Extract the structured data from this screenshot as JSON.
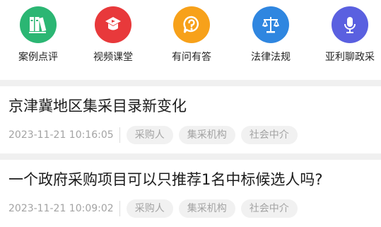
{
  "quick_nav": {
    "items": [
      {
        "label": "案例点评",
        "icon": "books-icon",
        "color": "#2bb673"
      },
      {
        "label": "视频课堂",
        "icon": "video-course-icon",
        "color": "#e8393b"
      },
      {
        "label": "有问有答",
        "icon": "question-bubble-icon",
        "color": "#f7a11a"
      },
      {
        "label": "法律法规",
        "icon": "scales-icon",
        "color": "#2f86e0"
      },
      {
        "label": "亚利聊政采",
        "icon": "microphone-icon",
        "color": "#5a60e0"
      }
    ]
  },
  "articles": [
    {
      "title": "京津冀地区集采目录新变化",
      "time": "2023-11-21 10:16:05",
      "tags": [
        "采购人",
        "集采机构",
        "社会中介"
      ]
    },
    {
      "title": "一个政府采购项目可以只推荐1名中标候选人吗?",
      "time": "2023-11-21 10:09:02",
      "tags": [
        "采购人",
        "集采机构",
        "社会中介"
      ]
    }
  ]
}
